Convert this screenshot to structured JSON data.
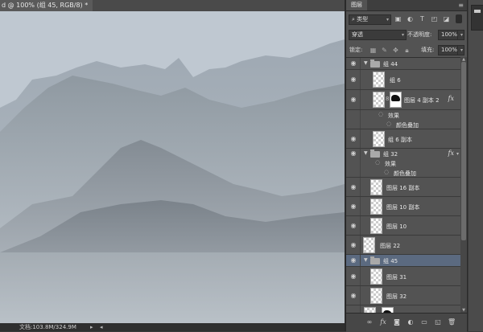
{
  "document": {
    "tab_title": "d @ 100% (组 45, RGB/8) *",
    "close_glyph": "×"
  },
  "status": {
    "doc_info": "文档:103.8M/324.9M",
    "arrow_left": "▸",
    "arrow_right": "◂"
  },
  "panel": {
    "title": "图层",
    "menu_glyph": "≡",
    "filter_kind": "类型",
    "search_glyph": "⌕",
    "filter_icons": [
      "image-filter-icon",
      "adjustment-filter-icon",
      "type-filter-icon",
      "shape-filter-icon",
      "smart-object-filter-icon"
    ],
    "blend_mode": "穿透",
    "opacity_label": "不透明度:",
    "opacity_value": "100%",
    "lock_label": "锁定:",
    "fill_label": "填充:",
    "fill_value": "100%",
    "dropdown_glyph": "▾"
  },
  "layers": [
    {
      "name": "组 44",
      "kind": "group",
      "expanded": true,
      "fx": false
    },
    {
      "name": "组 6",
      "kind": "layer",
      "fx": false
    },
    {
      "name": "图层 4 副本 2",
      "kind": "masked",
      "fx": true
    },
    {
      "name": "效果",
      "kind": "effect-header"
    },
    {
      "name": "颜色叠加",
      "kind": "effect"
    },
    {
      "name": "组 6 副本",
      "kind": "layer",
      "fx": false
    },
    {
      "name": "组 32",
      "kind": "group",
      "expanded": true,
      "fx": true
    },
    {
      "name": "效果",
      "kind": "effect-header"
    },
    {
      "name": "颜色叠加",
      "kind": "effect"
    },
    {
      "name": "图层 16 副本",
      "kind": "layer",
      "fx": false
    },
    {
      "name": "图层 10 副本",
      "kind": "layer",
      "fx": false
    },
    {
      "name": "图层 10",
      "kind": "layer",
      "fx": false
    },
    {
      "name": "图层 22",
      "kind": "layer",
      "fx": false
    },
    {
      "name": "组 45",
      "kind": "group",
      "expanded": true,
      "selected": true,
      "fx": false
    },
    {
      "name": "图层 31",
      "kind": "layer",
      "fx": false
    },
    {
      "name": "图层 32",
      "kind": "layer",
      "fx": false
    }
  ],
  "glyphs": {
    "eye": "◉",
    "expand": "▼",
    "fx": "fx",
    "fx_arrow": "▾",
    "chain": "8",
    "effect_eye": "◌"
  },
  "footer_icons": [
    "link-layers-icon",
    "add-style-icon",
    "add-mask-icon",
    "adjustment-layer-icon",
    "new-group-icon",
    "new-layer-icon",
    "delete-layer-icon"
  ],
  "footer_glyphs": [
    "∞",
    "fx",
    "◙",
    "◐",
    "▭",
    "◱",
    "🗑"
  ]
}
